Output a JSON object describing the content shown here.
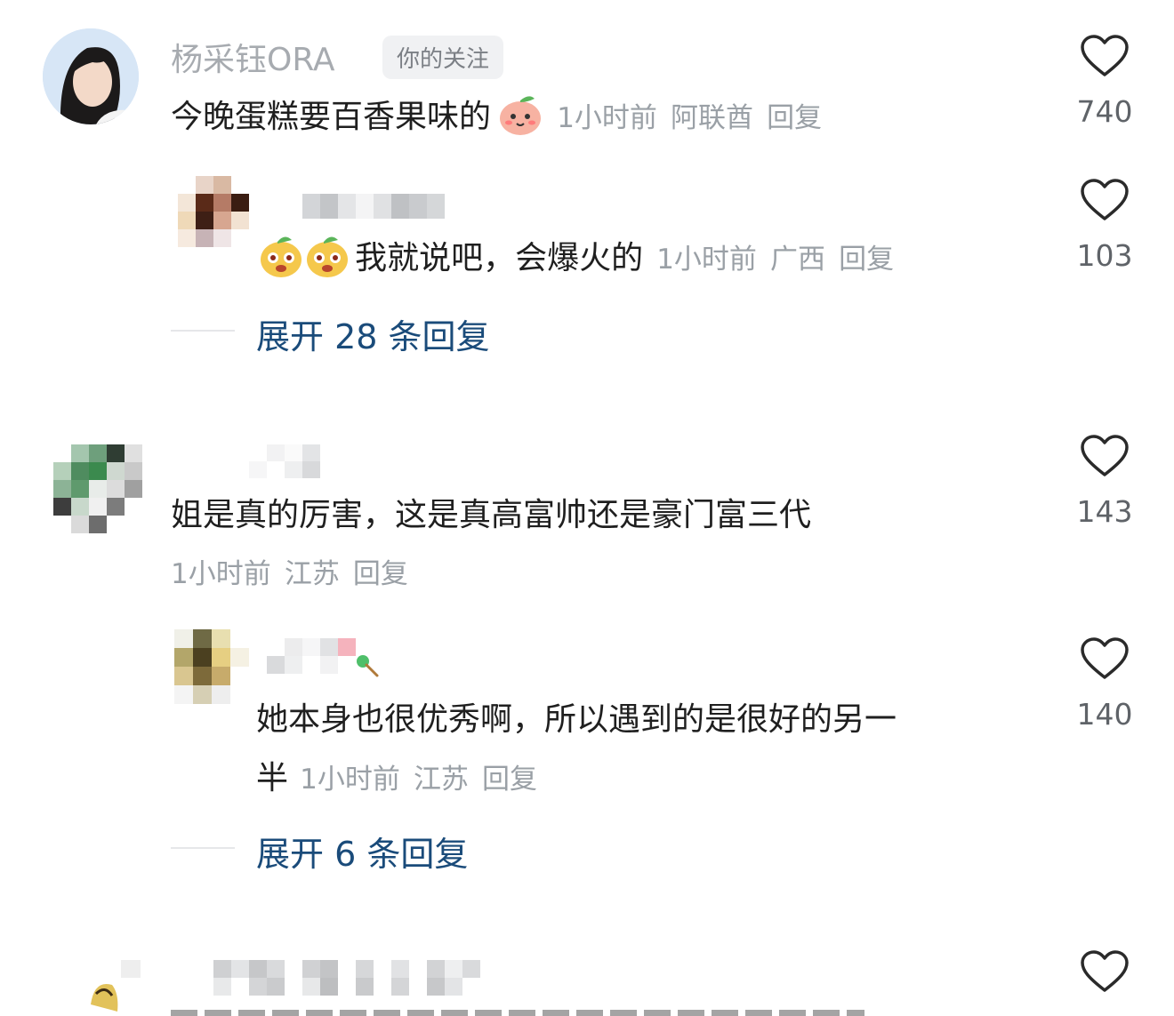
{
  "comments": [
    {
      "author": "杨采钰ORA",
      "tag": "你的关注",
      "text": "今晚蛋糕要百香果味的",
      "time": "1小时前",
      "location": "阿联酋",
      "reply": "回复",
      "likes": "740"
    },
    {
      "text": "我就说吧，会爆火的",
      "time": "1小时前",
      "location": "广西",
      "reply": "回复",
      "likes": "103"
    },
    {
      "text": "姐是真的厉害，这是真高富帅还是豪门富三代",
      "time": "1小时前",
      "location": "江苏",
      "reply": "回复",
      "likes": "143"
    },
    {
      "text_line1": "她本身也很优秀啊，所以遇到的是很好的另一",
      "text_line2": "半",
      "time": "1小时前",
      "location": "江苏",
      "reply": "回复",
      "likes": "140"
    }
  ],
  "expand1": "展开 28 条回复",
  "expand2": "展开 6 条回复",
  "colors": {
    "link": "#1a4b7a",
    "muted": "#9aa0a6",
    "text": "#1f1f1f"
  }
}
